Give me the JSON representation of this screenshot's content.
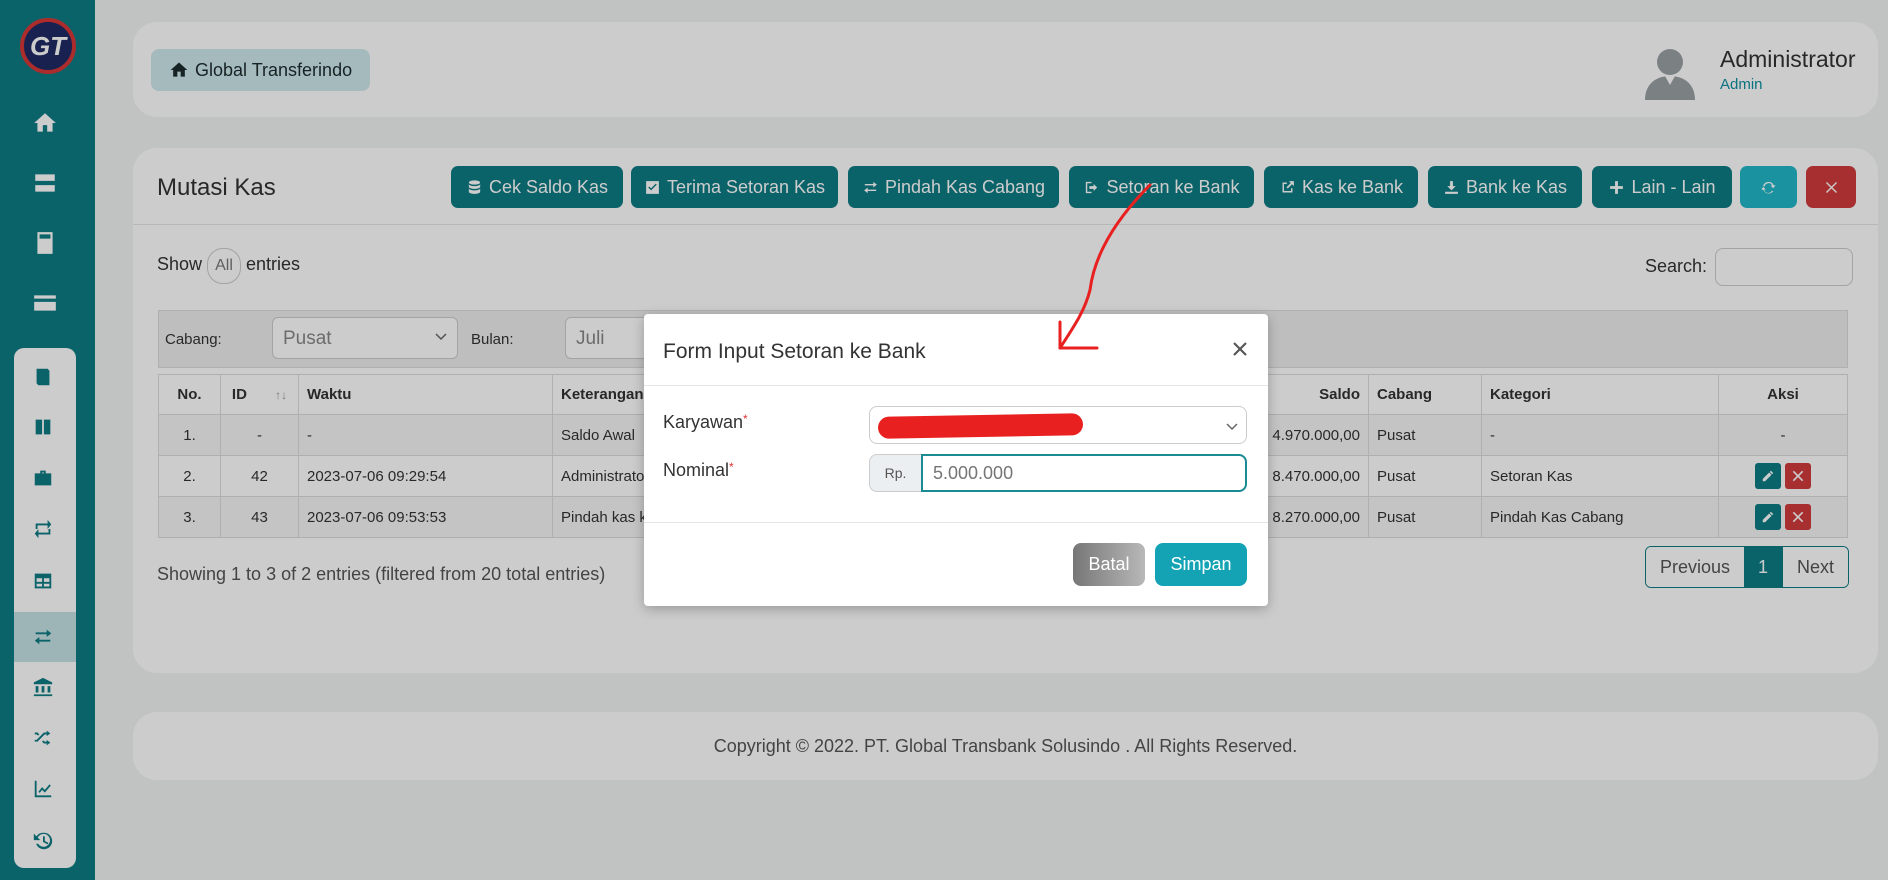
{
  "app": {
    "logo_text": "GT",
    "brand": "Global Transferindo"
  },
  "user": {
    "name": "Administrator",
    "role": "Admin"
  },
  "page": {
    "title": "Mutasi Kas",
    "toolbar": {
      "cek_saldo": "Cek Saldo Kas",
      "terima_setoran": "Terima Setoran Kas",
      "pindah_kas": "Pindah Kas Cabang",
      "setoran_bank": "Setoran ke Bank",
      "kas_ke_bank": "Kas ke Bank",
      "bank_ke_kas": "Bank ke Kas",
      "lain_lain": "Lain - Lain"
    },
    "show_label": "Show",
    "entries_value": "All",
    "entries_label": "entries",
    "search_label": "Search:",
    "filters": {
      "cabang_label": "Cabang:",
      "cabang_value": "Pusat",
      "bulan_label": "Bulan:",
      "bulan_value": "Juli"
    },
    "table": {
      "headers": {
        "no": "No.",
        "id": "ID",
        "waktu": "Waktu",
        "keterangan": "Keterangan",
        "saldo": "Saldo",
        "cabang": "Cabang",
        "kategori": "Kategori",
        "aksi": "Aksi"
      },
      "rows": [
        {
          "no": "1.",
          "id": "-",
          "waktu": "-",
          "keterangan": "Saldo Awal",
          "saldo": "4.970.000,00",
          "cabang": "Pusat",
          "kategori": "-",
          "aksi": "-"
        },
        {
          "no": "2.",
          "id": "42",
          "waktu": "2023-07-06 09:29:54",
          "keterangan": "Administrator",
          "saldo": "8.470.000,00",
          "cabang": "Pusat",
          "kategori": "Setoran Kas",
          "aksi": ""
        },
        {
          "no": "3.",
          "id": "43",
          "waktu": "2023-07-06 09:53:53",
          "keterangan": "Pindah kas ke",
          "saldo": "8.270.000,00",
          "cabang": "Pusat",
          "kategori": "Pindah Kas Cabang",
          "aksi": ""
        }
      ]
    },
    "showing": "Showing 1 to 3 of 2 entries (filtered from 20 total entries)",
    "pager": {
      "previous": "Previous",
      "current": "1",
      "next": "Next"
    }
  },
  "footer": {
    "text": "Copyright © 2022. PT. Global Transbank Solusindo . All Rights Reserved."
  },
  "modal": {
    "title": "Form Input Setoran ke Bank",
    "karyawan_label": "Karyawan",
    "nominal_label": "Nominal",
    "required_mark": "*",
    "currency_prefix": "Rp.",
    "nominal_placeholder": "5.000.000",
    "cancel": "Batal",
    "save": "Simpan"
  },
  "colors": {
    "primary": "#0e7c85",
    "accent": "#14a3b5",
    "danger": "#d33b3b",
    "annotation": "#e82020"
  }
}
